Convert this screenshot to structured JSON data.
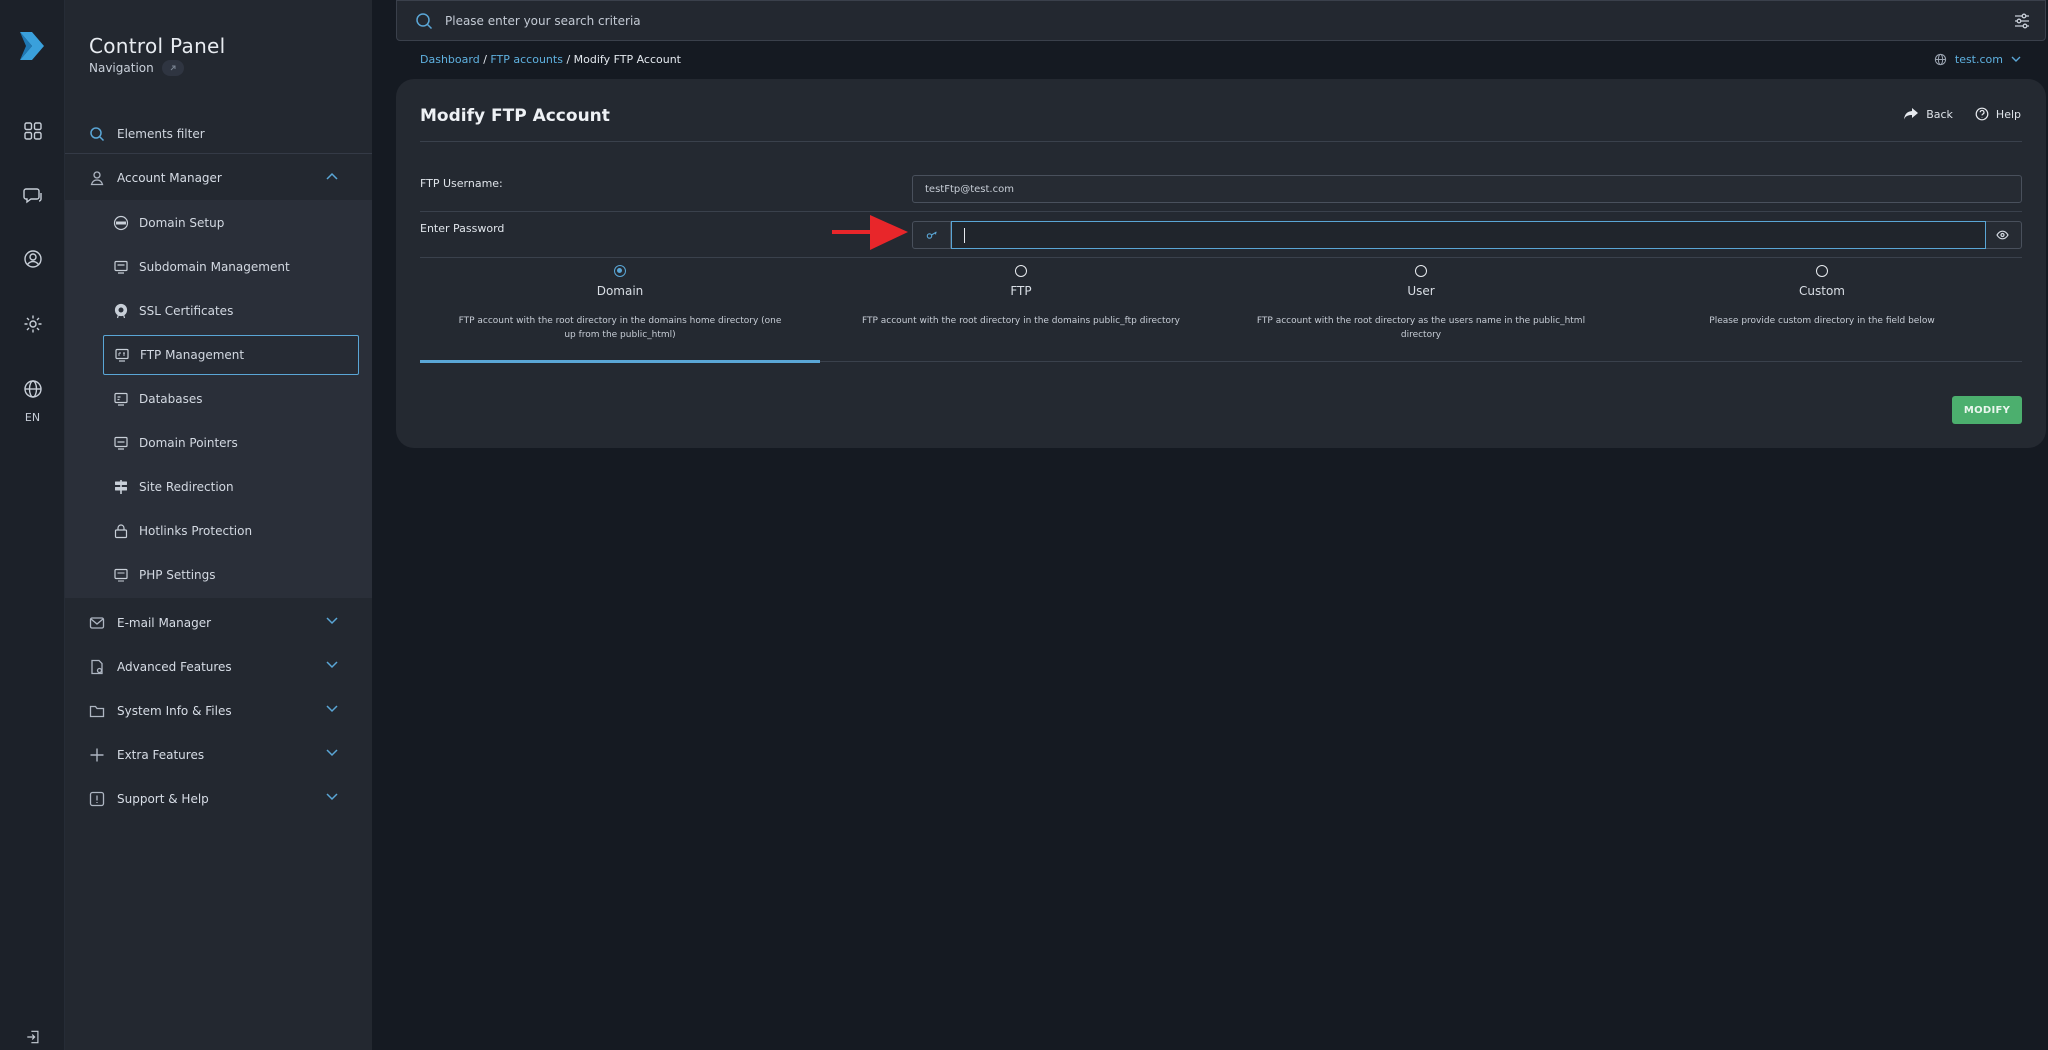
{
  "app": {
    "title": "Control Panel",
    "subtitle": "Navigation",
    "language": "EN"
  },
  "sidebar": {
    "filter_label": "Elements filter",
    "account_manager": "Account Manager",
    "sub_items": [
      {
        "label": "Domain Setup",
        "icon": "domain-icon"
      },
      {
        "label": "Subdomain Management",
        "icon": "monitor-icon"
      },
      {
        "label": "SSL Certificates",
        "icon": "certificate-icon"
      },
      {
        "label": "FTP Management",
        "icon": "ftp-icon",
        "active": true
      },
      {
        "label": "Databases",
        "icon": "database-icon"
      },
      {
        "label": "Domain Pointers",
        "icon": "pointer-icon"
      },
      {
        "label": "Site Redirection",
        "icon": "signpost-icon"
      },
      {
        "label": "Hotlinks Protection",
        "icon": "lock-icon"
      },
      {
        "label": "PHP Settings",
        "icon": "php-icon"
      }
    ],
    "sections": [
      {
        "label": "E-mail Manager",
        "icon": "mail-icon"
      },
      {
        "label": "Advanced Features",
        "icon": "document-gear-icon"
      },
      {
        "label": "System Info & Files",
        "icon": "folder-icon"
      },
      {
        "label": "Extra Features",
        "icon": "plus-icon"
      },
      {
        "label": "Support & Help",
        "icon": "alert-icon"
      }
    ]
  },
  "search": {
    "placeholder": "Please enter your search criteria"
  },
  "breadcrumb": {
    "items": [
      "Dashboard",
      "FTP accounts"
    ],
    "current": "Modify FTP Account"
  },
  "domain_selector": "test.com",
  "form": {
    "title": "Modify FTP Account",
    "back_label": "Back",
    "help_label": "Help",
    "username_label": "FTP Username:",
    "username_value": "testFtp@test.com",
    "password_label": "Enter Password",
    "password_value": "",
    "options": [
      {
        "name": "Domain",
        "desc": "FTP account with the root directory in the domains home directory (one up from the public_html)",
        "selected": true
      },
      {
        "name": "FTP",
        "desc": "FTP account with the root directory in the domains public_ftp directory",
        "selected": false
      },
      {
        "name": "User",
        "desc": "FTP account with the root directory as the users name in the public_html directory",
        "selected": false
      },
      {
        "name": "Custom",
        "desc": "Please provide custom directory in the field below",
        "selected": false
      }
    ],
    "submit_label": "MODIFY"
  },
  "colors": {
    "accent": "#5aa6d6",
    "submit": "#4caf6e",
    "annotation_arrow": "#e8262a"
  }
}
